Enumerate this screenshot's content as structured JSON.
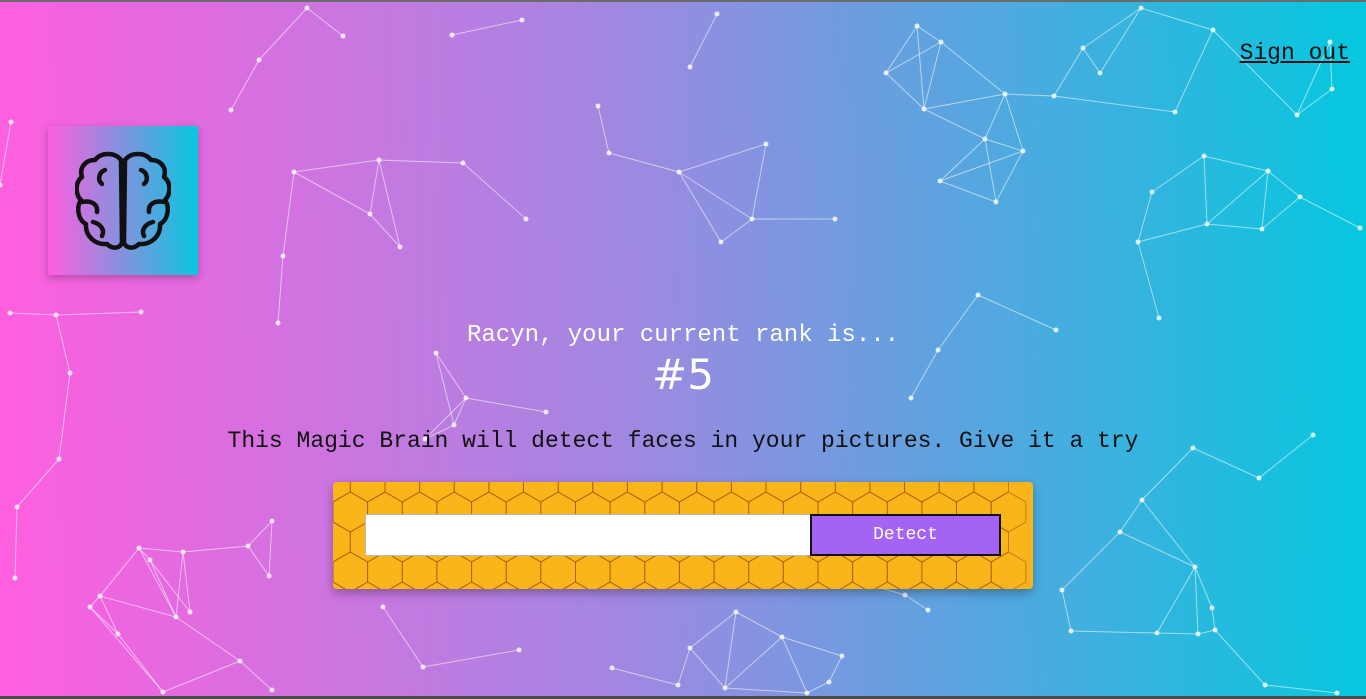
{
  "header": {
    "signout_label": "Sign out"
  },
  "logo": {
    "icon": "brain-icon"
  },
  "rank": {
    "label": "Racyn, your current rank is...",
    "value": "#5"
  },
  "image_link_form": {
    "description": "This Magic Brain will detect faces in your pictures. Give it a try",
    "input_value": "",
    "input_placeholder": "",
    "detect_label": "Detect"
  },
  "colors": {
    "gradient_start": "#ff5edf",
    "gradient_end": "#04c8de",
    "form_background": "#fbb51a",
    "detect_button": "#a463f2"
  }
}
